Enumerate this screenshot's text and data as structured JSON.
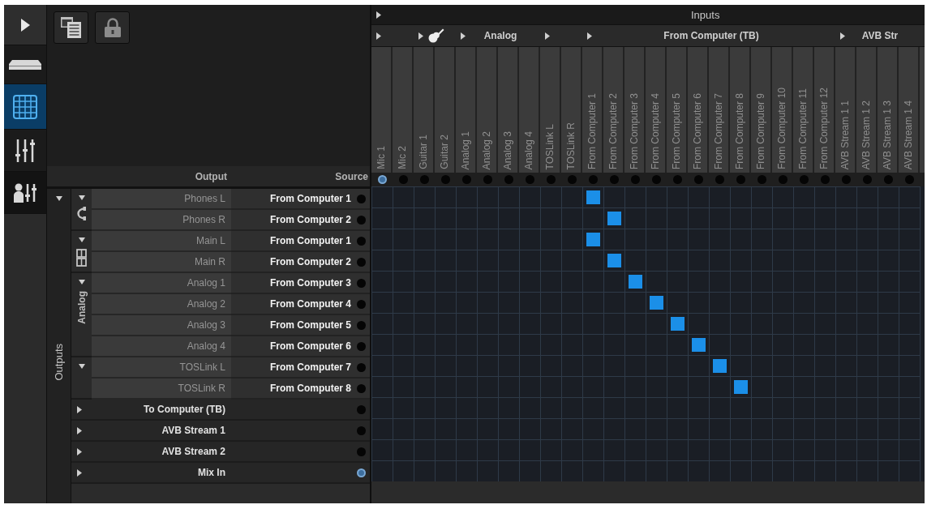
{
  "sidebar": {
    "items": [
      {
        "kind": "expand",
        "selected": false
      },
      {
        "kind": "device",
        "selected": false
      },
      {
        "kind": "routing",
        "selected": true
      },
      {
        "kind": "mixer",
        "selected": false
      },
      {
        "kind": "user-mixer",
        "selected": false
      }
    ]
  },
  "toolbar": {
    "buttons": [
      {
        "kind": "window-list"
      },
      {
        "kind": "lock"
      }
    ]
  },
  "outputs": {
    "title": "Outputs",
    "expanded": true,
    "columns": [
      "Output",
      "Source"
    ],
    "groups": [
      {
        "kind": "phones",
        "expanded": true,
        "channels": [
          {
            "name": "Phones L",
            "source": "From Computer 1",
            "active": false
          },
          {
            "name": "Phones R",
            "source": "From Computer 2",
            "active": false
          }
        ]
      },
      {
        "kind": "main",
        "expanded": true,
        "channels": [
          {
            "name": "Main L",
            "source": "From Computer 1",
            "active": false
          },
          {
            "name": "Main R",
            "source": "From Computer 2",
            "active": false
          }
        ]
      },
      {
        "kind": "labeled",
        "label": "Analog",
        "expanded": true,
        "channels": [
          {
            "name": "Analog 1",
            "source": "From Computer 3",
            "active": false
          },
          {
            "name": "Analog 2",
            "source": "From Computer 4",
            "active": false
          },
          {
            "name": "Analog 3",
            "source": "From Computer 5",
            "active": false
          },
          {
            "name": "Analog 4",
            "source": "From Computer 6",
            "active": false
          }
        ]
      },
      {
        "kind": "plain",
        "expanded": true,
        "channels": [
          {
            "name": "TOSLink L",
            "source": "From Computer 7",
            "active": false
          },
          {
            "name": "TOSLink R",
            "source": "From Computer 8",
            "active": false
          }
        ]
      },
      {
        "kind": "plain",
        "label": "To Computer (TB)",
        "expanded": false,
        "active": false
      },
      {
        "kind": "plain",
        "label": "AVB Stream 1",
        "expanded": false,
        "active": false
      },
      {
        "kind": "plain",
        "label": "AVB Stream 2",
        "expanded": false,
        "active": false
      },
      {
        "kind": "plain",
        "label": "Mix In",
        "expanded": false,
        "active": true
      }
    ]
  },
  "inputs": {
    "title": "Inputs",
    "groups": [
      {
        "kind": "plain",
        "channels": [
          {
            "name": "Mic 1",
            "active": true
          },
          {
            "name": "Mic 2",
            "active": false
          }
        ]
      },
      {
        "kind": "guitar",
        "channels": [
          {
            "name": "Guitar 1",
            "active": false
          },
          {
            "name": "Guitar 2",
            "active": false
          }
        ]
      },
      {
        "kind": "labeled",
        "label": "Analog",
        "channels": [
          {
            "name": "Analog 1",
            "active": false
          },
          {
            "name": "Analog 2",
            "active": false
          },
          {
            "name": "Analog 3",
            "active": false
          },
          {
            "name": "Analog 4",
            "active": false
          }
        ]
      },
      {
        "kind": "plain",
        "channels": [
          {
            "name": "TOSLink L",
            "active": false
          },
          {
            "name": "TOSLink R",
            "active": false
          }
        ]
      },
      {
        "kind": "labeled",
        "label": "From Computer (TB)",
        "channels": [
          {
            "name": "From Computer 1",
            "active": false
          },
          {
            "name": "From Computer 2",
            "active": false
          },
          {
            "name": "From Computer 3",
            "active": false
          },
          {
            "name": "From Computer 4",
            "active": false
          },
          {
            "name": "From Computer 5",
            "active": false
          },
          {
            "name": "From Computer 6",
            "active": false
          },
          {
            "name": "From Computer 7",
            "active": false
          },
          {
            "name": "From Computer 8",
            "active": false
          },
          {
            "name": "From Computer 9",
            "active": false
          },
          {
            "name": "From Computer 10",
            "active": false
          },
          {
            "name": "From Computer 11",
            "active": false
          },
          {
            "name": "From Computer 12",
            "active": false
          }
        ]
      },
      {
        "kind": "labeled",
        "label": "AVB Str",
        "channels": [
          {
            "name": "AVB Stream 1 1",
            "active": false
          },
          {
            "name": "AVB Stream 1 2",
            "active": false
          },
          {
            "name": "AVB Stream 1 3",
            "active": false
          },
          {
            "name": "AVB Stream 1 4",
            "active": false
          }
        ]
      }
    ]
  },
  "matrix": {
    "rows": [
      [
        false,
        false,
        false,
        false,
        false,
        false,
        false,
        false,
        false,
        false,
        true,
        false,
        false,
        false,
        false,
        false,
        false,
        false,
        false,
        false,
        false,
        false,
        false,
        false,
        false,
        false
      ],
      [
        false,
        false,
        false,
        false,
        false,
        false,
        false,
        false,
        false,
        false,
        false,
        true,
        false,
        false,
        false,
        false,
        false,
        false,
        false,
        false,
        false,
        false,
        false,
        false,
        false,
        false
      ],
      [
        false,
        false,
        false,
        false,
        false,
        false,
        false,
        false,
        false,
        false,
        true,
        false,
        false,
        false,
        false,
        false,
        false,
        false,
        false,
        false,
        false,
        false,
        false,
        false,
        false,
        false
      ],
      [
        false,
        false,
        false,
        false,
        false,
        false,
        false,
        false,
        false,
        false,
        false,
        true,
        false,
        false,
        false,
        false,
        false,
        false,
        false,
        false,
        false,
        false,
        false,
        false,
        false,
        false
      ],
      [
        false,
        false,
        false,
        false,
        false,
        false,
        false,
        false,
        false,
        false,
        false,
        false,
        true,
        false,
        false,
        false,
        false,
        false,
        false,
        false,
        false,
        false,
        false,
        false,
        false,
        false
      ],
      [
        false,
        false,
        false,
        false,
        false,
        false,
        false,
        false,
        false,
        false,
        false,
        false,
        false,
        true,
        false,
        false,
        false,
        false,
        false,
        false,
        false,
        false,
        false,
        false,
        false,
        false
      ],
      [
        false,
        false,
        false,
        false,
        false,
        false,
        false,
        false,
        false,
        false,
        false,
        false,
        false,
        false,
        true,
        false,
        false,
        false,
        false,
        false,
        false,
        false,
        false,
        false,
        false,
        false
      ],
      [
        false,
        false,
        false,
        false,
        false,
        false,
        false,
        false,
        false,
        false,
        false,
        false,
        false,
        false,
        false,
        true,
        false,
        false,
        false,
        false,
        false,
        false,
        false,
        false,
        false,
        false
      ],
      [
        false,
        false,
        false,
        false,
        false,
        false,
        false,
        false,
        false,
        false,
        false,
        false,
        false,
        false,
        false,
        false,
        true,
        false,
        false,
        false,
        false,
        false,
        false,
        false,
        false,
        false
      ],
      [
        false,
        false,
        false,
        false,
        false,
        false,
        false,
        false,
        false,
        false,
        false,
        false,
        false,
        false,
        false,
        false,
        false,
        true,
        false,
        false,
        false,
        false,
        false,
        false,
        false,
        false
      ],
      [
        false,
        false,
        false,
        false,
        false,
        false,
        false,
        false,
        false,
        false,
        false,
        false,
        false,
        false,
        false,
        false,
        false,
        false,
        false,
        false,
        false,
        false,
        false,
        false,
        false,
        false
      ],
      [
        false,
        false,
        false,
        false,
        false,
        false,
        false,
        false,
        false,
        false,
        false,
        false,
        false,
        false,
        false,
        false,
        false,
        false,
        false,
        false,
        false,
        false,
        false,
        false,
        false,
        false
      ],
      [
        false,
        false,
        false,
        false,
        false,
        false,
        false,
        false,
        false,
        false,
        false,
        false,
        false,
        false,
        false,
        false,
        false,
        false,
        false,
        false,
        false,
        false,
        false,
        false,
        false,
        false
      ],
      [
        false,
        false,
        false,
        false,
        false,
        false,
        false,
        false,
        false,
        false,
        false,
        false,
        false,
        false,
        false,
        false,
        false,
        false,
        false,
        false,
        false,
        false,
        false,
        false,
        false,
        false
      ]
    ]
  }
}
